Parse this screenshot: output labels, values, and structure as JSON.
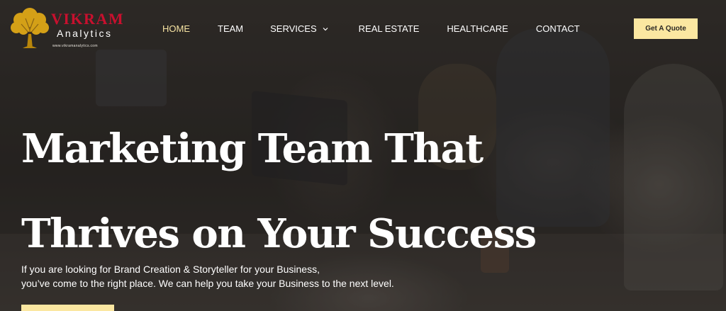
{
  "brand": {
    "name": "VIKRAM",
    "subtitle": "Analytics",
    "url": "www.vikramanalytics.com",
    "brand_color": "#c8102e",
    "tree_color": "#d4a017"
  },
  "nav": {
    "items": [
      {
        "label": "HOME",
        "active": true
      },
      {
        "label": "TEAM"
      },
      {
        "label": "SERVICES",
        "icon": "chevron-down-icon"
      },
      {
        "label": "REAL ESTATE"
      },
      {
        "label": "HEALTHCARE"
      },
      {
        "label": "CONTACT"
      }
    ],
    "active_color": "#f6e3a2"
  },
  "header": {
    "quote_label": "Get A Quote",
    "quote_bg": "#fbe7a1"
  },
  "hero": {
    "title_line1": "Marketing Team That",
    "title_line2": "Thrives on Your Success",
    "subtitle_line1": "If you are looking for Brand Creation & Storyteller for your Business,",
    "subtitle_line2": "you’ve come to the right place. We can help you take your Business to the next level."
  }
}
